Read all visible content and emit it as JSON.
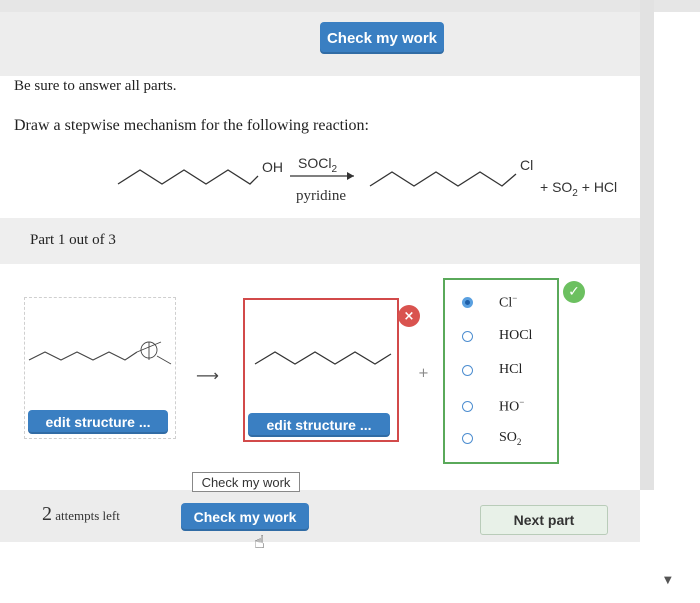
{
  "header": {
    "check_button_label": "Check my work"
  },
  "instructions": {
    "line1": "Be sure to answer all parts.",
    "line2": "Draw a stepwise mechanism for the following reaction:"
  },
  "reaction": {
    "reactant_group": "OH",
    "reagent": "SOCl",
    "reagent_subscript": "2",
    "solvent": "pyridine",
    "product_group": "Cl",
    "byproducts_prefix": "+ SO",
    "byproducts_subscript": "2",
    "byproducts_suffix": " + HCl"
  },
  "part": {
    "label": "Part 1 out of 3"
  },
  "workspace": {
    "edit_button_label_1": "edit structure ...",
    "edit_button_label_2": "edit structure ...",
    "error_mark": "×",
    "plus": "+",
    "correct_mark": "✓",
    "choices": [
      {
        "base": "Cl",
        "sup": "−",
        "sub": "",
        "selected": true
      },
      {
        "base": "HOCl",
        "sup": "",
        "sub": "",
        "selected": false
      },
      {
        "base": "HCl",
        "sup": "",
        "sub": "",
        "selected": false
      },
      {
        "base": "HO",
        "sup": "−",
        "sub": "",
        "selected": false
      },
      {
        "base": "SO",
        "sup": "",
        "sub": "2",
        "selected": false
      }
    ]
  },
  "footer": {
    "tooltip": "Check my work",
    "attempts_number": "2",
    "attempts_text": "attempts left",
    "check_button_label": "Check my work",
    "next_button_label": "Next part"
  },
  "colors": {
    "button_blue": "#3a7fc2",
    "error_red": "#d24a4a",
    "correct_green": "#6cc060",
    "choice_border_green": "#5aa95a"
  },
  "icons": [
    "close-icon",
    "checkmark-icon",
    "hand-cursor-icon",
    "arrow-right-icon",
    "scroll-down-icon"
  ]
}
